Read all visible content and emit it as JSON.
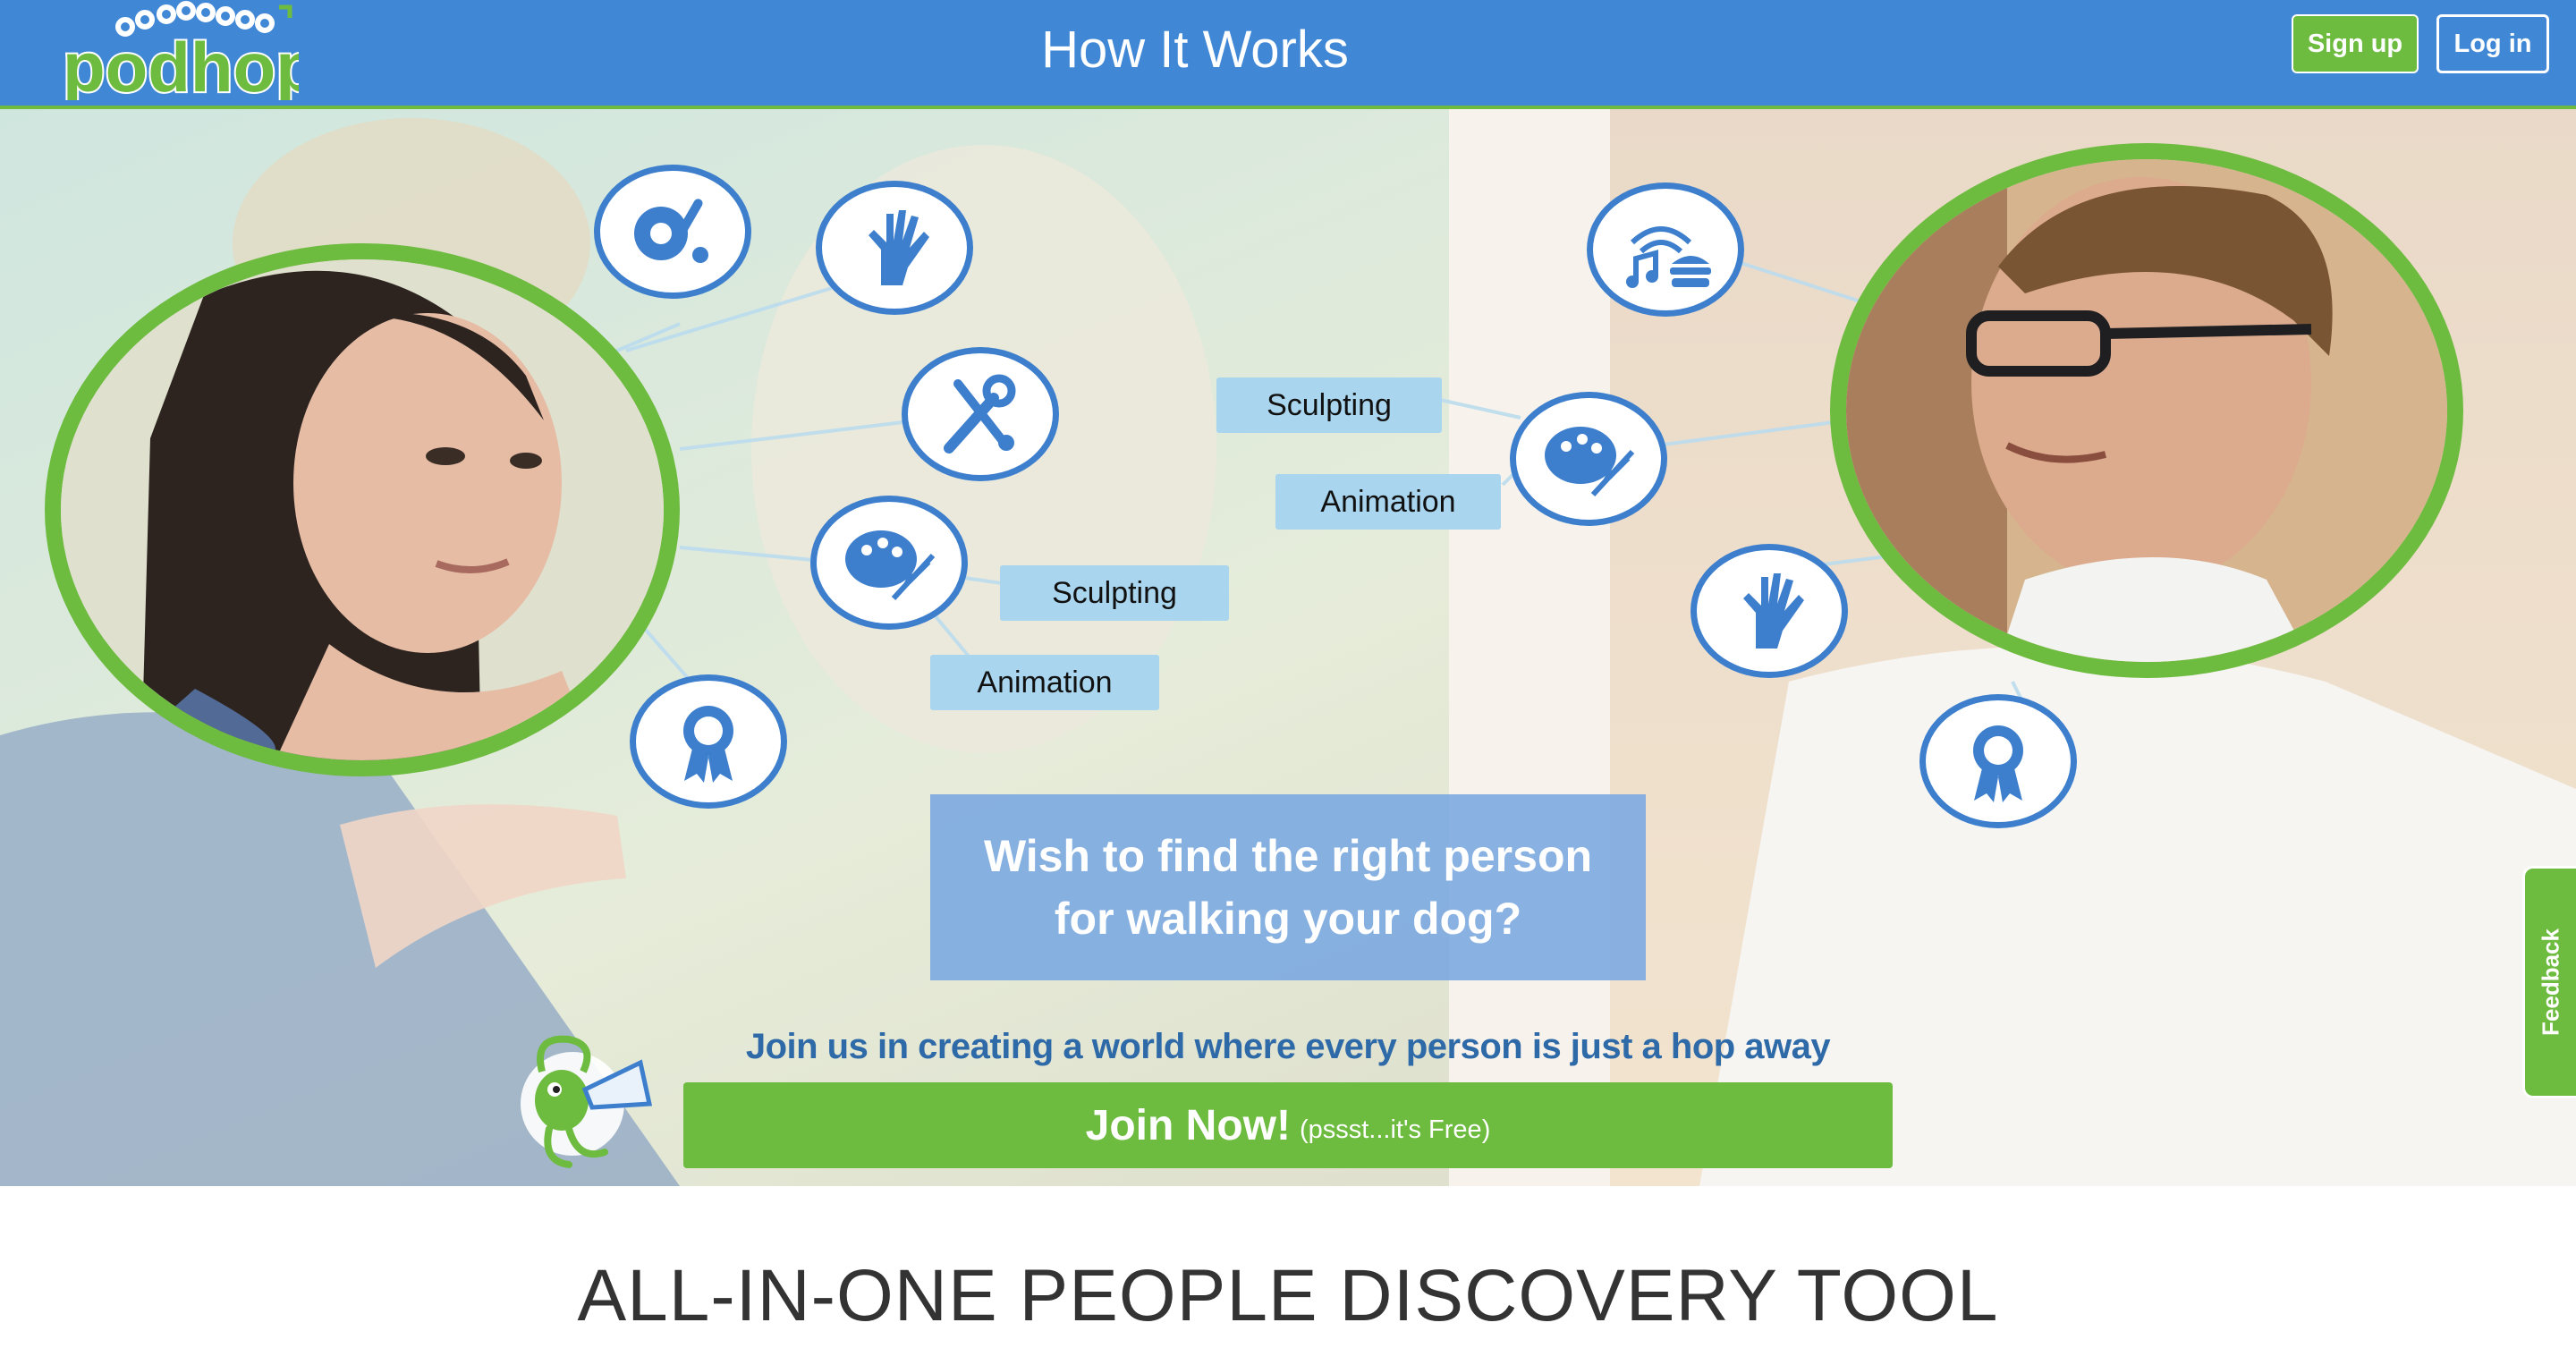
{
  "header": {
    "logo_text": "podhop",
    "title": "How It Works",
    "signup_label": "Sign up",
    "login_label": "Log in"
  },
  "hero": {
    "tags_left": [
      "Sculpting",
      "Animation"
    ],
    "tags_right": [
      "Sculpting",
      "Animation"
    ],
    "wish_text": "Wish to find the right person for walking your dog?",
    "join_text": "Join us in creating a world where every person is just a hop away",
    "join_button": "Join Now!",
    "join_button_sub": "(pssst...it's Free)"
  },
  "feedback_label": "Feedback",
  "section_title": "ALL-IN-ONE PEOPLE DISCOVERY TOOL",
  "icons": [
    "sports-icon",
    "hand-icon",
    "tools-icon",
    "art-palette-icon",
    "award-ribbon-icon",
    "music-food-icon"
  ],
  "colors": {
    "header_blue": "#4088d6",
    "brand_green": "#6dbb3f",
    "icon_blue": "#3d7fcd",
    "tag_blue": "#a9d5ee",
    "join_text_blue": "#2f6aa8"
  }
}
